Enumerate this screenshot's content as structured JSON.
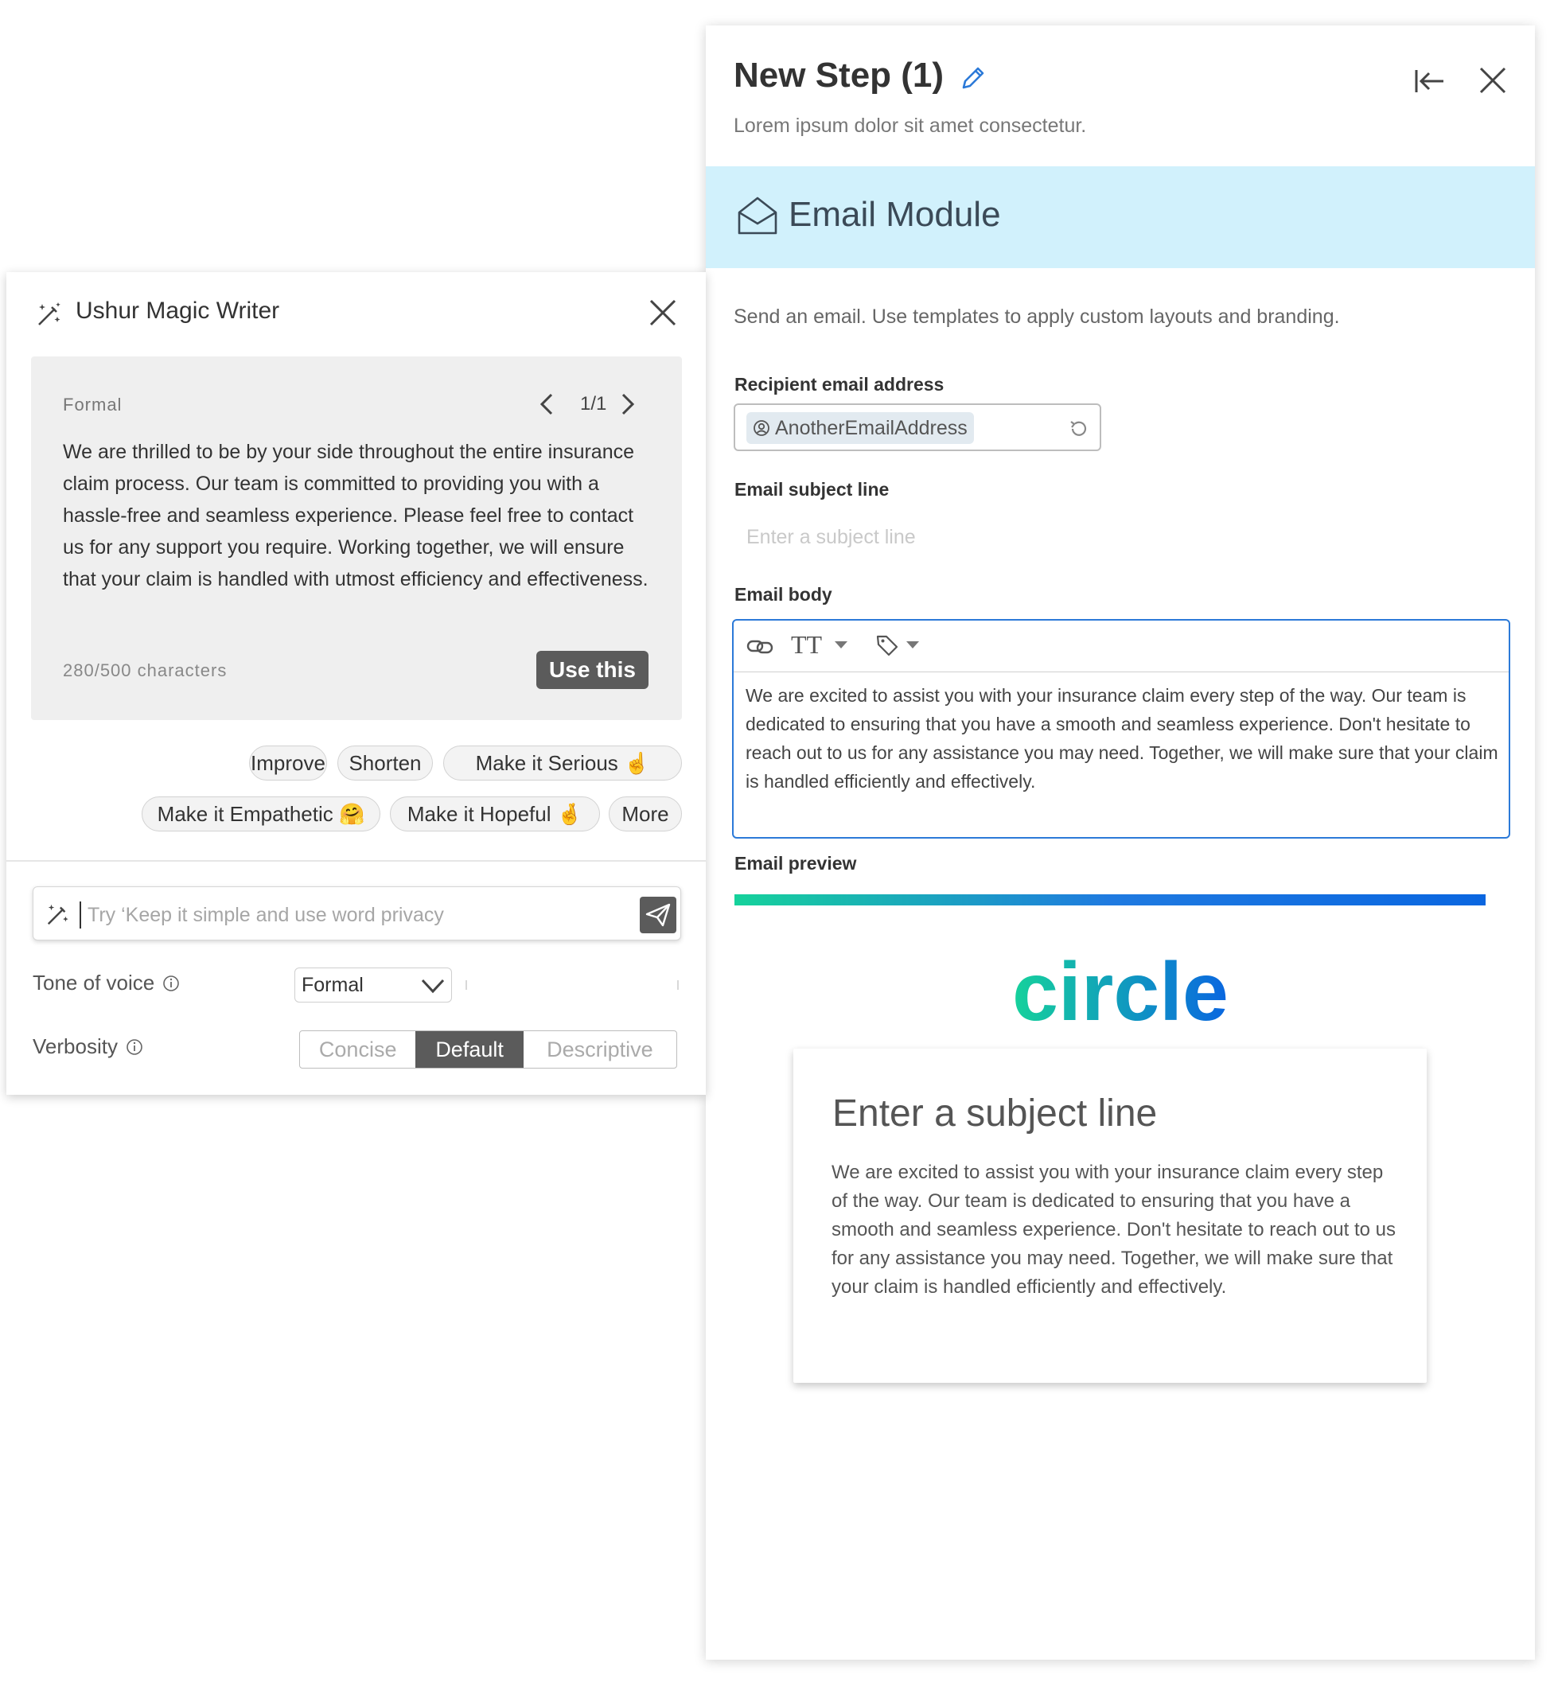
{
  "step_panel": {
    "title": "New Step (1)",
    "subtitle": "Lorem ipsum dolor sit amet consectetur.",
    "module_title": "Email Module",
    "module_description": "Send an email. Use templates to apply custom layouts and branding.",
    "recipient": {
      "label": "Recipient email address",
      "chip": "AnotherEmailAddress"
    },
    "subject": {
      "label": "Email subject line",
      "placeholder": "Enter a subject line",
      "value": ""
    },
    "body": {
      "label": "Email body",
      "toolbar": {
        "text_style_glyph": "TT"
      },
      "text": "We are excited to assist you with your insurance claim every step of the way. Our team is dedicated to ensuring that you have a smooth and seamless experience. Don't hesitate to reach out to us for any assistance you may need. Together, we will make sure that your claim is handled efficiently and effectively."
    },
    "preview": {
      "label": "Email preview",
      "logo": "circle",
      "subject": "Enter a subject line",
      "body": "We are excited to assist you with your insurance claim every step of the way. Our team is dedicated to ensuring that you have a smooth and seamless experience. Don't hesitate to reach out to us for any assistance you may need. Together, we will make sure that your claim is handled efficiently and effectively."
    },
    "icons": [
      "pencil-icon",
      "collapse-left-icon",
      "close-icon",
      "envelope-open-icon",
      "person-icon",
      "refresh-icon",
      "link-icon",
      "tag-icon"
    ]
  },
  "magic_writer": {
    "title": "Ushur Magic Writer",
    "suggestion": {
      "tone": "Formal",
      "pager": "1/1",
      "text": "We are thrilled to be by your side throughout the entire insurance claim process. Our team is committed to providing you with a hassle-free and seamless experience. Please feel free to contact us for any support you require. Working together, we will ensure that your claim is handled with utmost efficiency and effectiveness.",
      "char_count": "280/500 characters",
      "use_label": "Use this"
    },
    "actions": [
      {
        "label": "Improve"
      },
      {
        "label": "Shorten"
      },
      {
        "label": "Make it Serious ☝️"
      },
      {
        "label": "Make it Empathetic 🤗"
      },
      {
        "label": "Make it Hopeful 🤞"
      },
      {
        "label": "More"
      }
    ],
    "prompt": {
      "placeholder": "Try ‘Keep it simple and use word privacy",
      "value": ""
    },
    "tone_of_voice": {
      "label": "Tone of voice",
      "selected": "Formal"
    },
    "verbosity": {
      "label": "Verbosity",
      "options": [
        "Concise",
        "Default",
        "Descriptive"
      ],
      "selected": "Default"
    },
    "icons": [
      "magic-wand-icon",
      "close-icon",
      "chevron-left-icon",
      "chevron-right-icon",
      "send-icon",
      "info-icon",
      "chevron-down-icon"
    ]
  },
  "colors": {
    "module_band": "#d1f1fc",
    "accent_blue": "#2c7ad8",
    "dark_button": "#5b5b5b",
    "logo_green": "#16d29b",
    "logo_blue": "#0a66e0"
  }
}
